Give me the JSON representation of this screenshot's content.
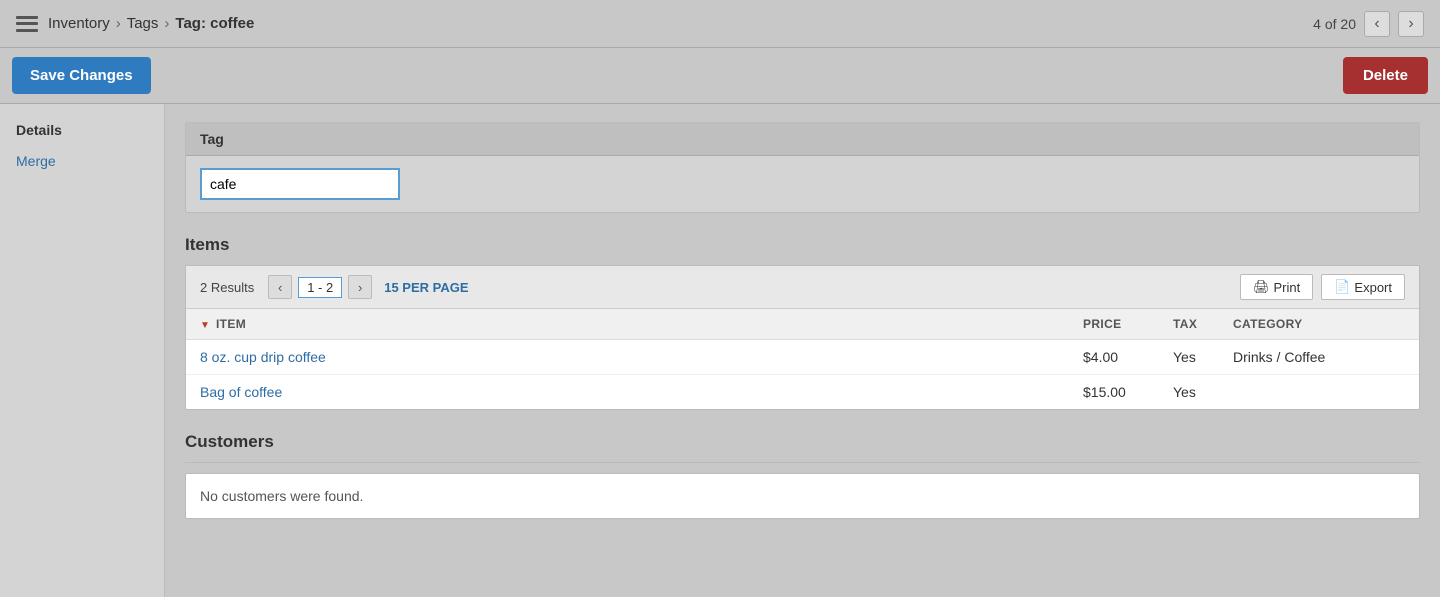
{
  "nav": {
    "icon": "menu-icon",
    "breadcrumbs": [
      "Inventory",
      "Tags",
      "Tag: coffee"
    ],
    "pagination": "4 of 20",
    "prev_label": "‹",
    "next_label": "›"
  },
  "actionbar": {
    "save_label": "Save Changes",
    "delete_label": "Delete"
  },
  "sidebar": {
    "section_title": "Details",
    "items": [
      {
        "label": "Merge"
      }
    ]
  },
  "tag_section": {
    "header": "Tag",
    "input_value": "cafe"
  },
  "items_section": {
    "title": "Items",
    "results_count": "2 Results",
    "page_range": "1 - 2",
    "per_page": "15 PER PAGE",
    "print_label": "Print",
    "export_label": "Export",
    "columns": [
      {
        "label": "ITEM",
        "sorted": true
      },
      {
        "label": "PRICE",
        "sorted": false
      },
      {
        "label": "TAX",
        "sorted": false
      },
      {
        "label": "CATEGORY",
        "sorted": false
      }
    ],
    "rows": [
      {
        "name": "8 oz. cup drip coffee",
        "price": "$4.00",
        "tax": "Yes",
        "category": "Drinks / Coffee"
      },
      {
        "name": "Bag of coffee",
        "price": "$15.00",
        "tax": "Yes",
        "category": ""
      }
    ]
  },
  "customers_section": {
    "title": "Customers",
    "empty_message": "No customers were found."
  }
}
